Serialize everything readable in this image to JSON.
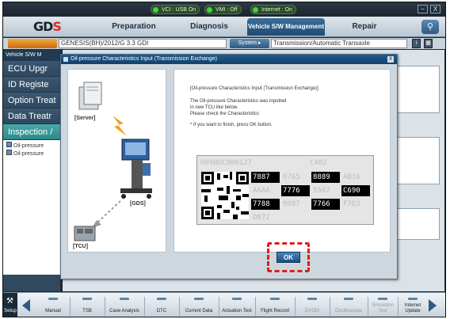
{
  "status": {
    "vci": "VCI : USB On",
    "vmi": "VMI : Off",
    "internet": "Internet : On"
  },
  "window": {
    "minimize": "−",
    "close": "X"
  },
  "nav": {
    "logo_main": "GD",
    "logo_accent": "S",
    "tabs": [
      {
        "label": "Preparation",
        "active": false
      },
      {
        "label": "Diagnosis",
        "active": false
      },
      {
        "label": "Vehicle S/W Management",
        "active": true
      },
      {
        "label": "Repair",
        "active": false
      }
    ],
    "search_icon": "search-icon"
  },
  "vehicle": {
    "model": "GENESIS(BH)/2012/G 3.3 GDI",
    "system_button": "System ▸",
    "system": "Transmission/Automatic Transaxle"
  },
  "sidebar": {
    "title": "Vehicle S/W M",
    "items": [
      {
        "label": "ECU Upgr",
        "active": false
      },
      {
        "label": "ID Registe",
        "active": false
      },
      {
        "label": "Option Treat",
        "active": false
      },
      {
        "label": "Data Treatr",
        "active": false
      },
      {
        "label": "Inspection /",
        "active": true
      }
    ],
    "subitems": [
      "Oil-pressure",
      "Oil-pressure"
    ]
  },
  "dialog": {
    "title": "Oil-pressure Characteristics Input (Transmission Exchange)",
    "close": "X",
    "illustration": {
      "server": "[Server]",
      "gds": "[GDS]",
      "tcu": "[TCU]"
    },
    "message": [
      "[Oil-pressure Characteristics Input (Transmission Exchange)]",
      "The Oil-pressure Characteristics was inputted",
      "in new TCU like below.",
      "Please check the Characteristics",
      "* If you want to finish, press OK button."
    ],
    "codes": {
      "serial": "H99BDC000127",
      "suffix": "CA02",
      "rows": [
        [
          {
            "t": "7887",
            "dark": true
          },
          {
            "t": "6765",
            "dark": false
          },
          {
            "t": "8889",
            "dark": true
          },
          {
            "t": "AB16",
            "dark": false
          }
        ],
        [
          {
            "t": "AAAA",
            "dark": false
          },
          {
            "t": "7776",
            "dark": true
          },
          {
            "t": "5567",
            "dark": false
          },
          {
            "t": "C690",
            "dark": true
          }
        ],
        [
          {
            "t": "7788",
            "dark": true
          },
          {
            "t": "9987",
            "dark": false
          },
          {
            "t": "7766",
            "dark": true
          },
          {
            "t": "F7D3",
            "dark": false
          }
        ]
      ],
      "last": "D872"
    },
    "ok": "OK"
  },
  "toolbar": {
    "setup": "Setup",
    "buttons": [
      "Manual",
      "TSB",
      "Case Analysis",
      "DTC",
      "Current Data",
      "Actuation Test",
      "Flight Record",
      "DVOM",
      "Oscilloscope",
      "Simulation Test",
      "Internet Update"
    ],
    "dimmed": [
      false,
      false,
      false,
      false,
      false,
      false,
      false,
      true,
      true,
      true,
      false
    ]
  }
}
